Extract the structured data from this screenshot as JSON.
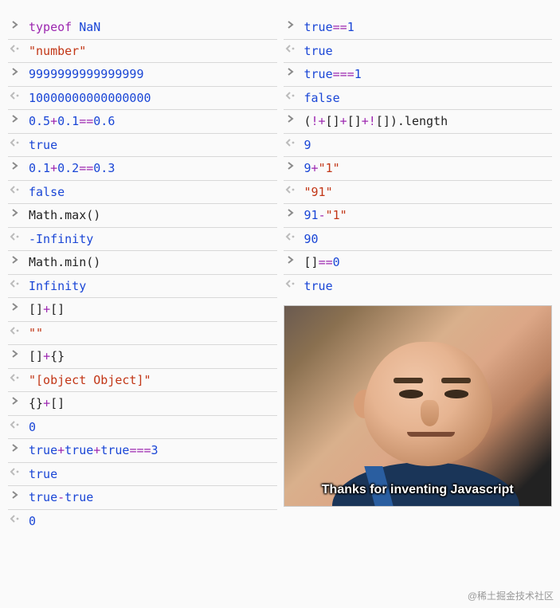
{
  "left": [
    {
      "type": "in",
      "tokens": [
        [
          "kw",
          "typeof"
        ],
        [
          "plain",
          " "
        ],
        [
          "num",
          "NaN"
        ]
      ]
    },
    {
      "type": "out",
      "tokens": [
        [
          "str",
          "\"number\""
        ]
      ]
    },
    {
      "type": "in",
      "tokens": [
        [
          "num",
          "9999999999999999"
        ]
      ]
    },
    {
      "type": "out",
      "tokens": [
        [
          "num",
          "10000000000000000"
        ]
      ]
    },
    {
      "type": "in",
      "tokens": [
        [
          "num",
          "0.5"
        ],
        [
          "op",
          "+"
        ],
        [
          "num",
          "0.1"
        ],
        [
          "op",
          "=="
        ],
        [
          "num",
          "0.6"
        ]
      ]
    },
    {
      "type": "out",
      "tokens": [
        [
          "bool",
          "true"
        ]
      ]
    },
    {
      "type": "in",
      "tokens": [
        [
          "num",
          "0.1"
        ],
        [
          "op",
          "+"
        ],
        [
          "num",
          "0.2"
        ],
        [
          "op",
          "=="
        ],
        [
          "num",
          "0.3"
        ]
      ]
    },
    {
      "type": "out",
      "tokens": [
        [
          "bool",
          "false"
        ]
      ]
    },
    {
      "type": "in",
      "tokens": [
        [
          "ident",
          "Math.max()"
        ]
      ]
    },
    {
      "type": "out",
      "tokens": [
        [
          "num",
          "-Infinity"
        ]
      ]
    },
    {
      "type": "in",
      "tokens": [
        [
          "ident",
          "Math.min()"
        ]
      ]
    },
    {
      "type": "out",
      "tokens": [
        [
          "num",
          "Infinity"
        ]
      ]
    },
    {
      "type": "in",
      "tokens": [
        [
          "plain",
          "[]"
        ],
        [
          "op",
          "+"
        ],
        [
          "plain",
          "[]"
        ]
      ]
    },
    {
      "type": "out",
      "tokens": [
        [
          "str",
          "\"\""
        ]
      ]
    },
    {
      "type": "in",
      "tokens": [
        [
          "plain",
          "[]"
        ],
        [
          "op",
          "+"
        ],
        [
          "plain",
          "{}"
        ]
      ]
    },
    {
      "type": "out",
      "tokens": [
        [
          "str",
          "\"[object Object]\""
        ]
      ]
    },
    {
      "type": "in",
      "tokens": [
        [
          "plain",
          "{}"
        ],
        [
          "op",
          "+"
        ],
        [
          "plain",
          "[]"
        ]
      ]
    },
    {
      "type": "out",
      "tokens": [
        [
          "num",
          "0"
        ]
      ]
    },
    {
      "type": "in",
      "tokens": [
        [
          "bool",
          "true"
        ],
        [
          "op",
          "+"
        ],
        [
          "bool",
          "true"
        ],
        [
          "op",
          "+"
        ],
        [
          "bool",
          "true"
        ],
        [
          "op",
          "==="
        ],
        [
          "num",
          "3"
        ]
      ]
    },
    {
      "type": "out",
      "tokens": [
        [
          "bool",
          "true"
        ]
      ]
    },
    {
      "type": "in",
      "tokens": [
        [
          "bool",
          "true"
        ],
        [
          "op",
          "-"
        ],
        [
          "bool",
          "true"
        ]
      ]
    },
    {
      "type": "out",
      "tokens": [
        [
          "num",
          "0"
        ]
      ]
    }
  ],
  "right": [
    {
      "type": "in",
      "tokens": [
        [
          "bool",
          "true"
        ],
        [
          "op",
          "=="
        ],
        [
          "num",
          "1"
        ]
      ]
    },
    {
      "type": "out",
      "tokens": [
        [
          "bool",
          "true"
        ]
      ]
    },
    {
      "type": "in",
      "tokens": [
        [
          "bool",
          "true"
        ],
        [
          "op",
          "==="
        ],
        [
          "num",
          "1"
        ]
      ]
    },
    {
      "type": "out",
      "tokens": [
        [
          "bool",
          "false"
        ]
      ]
    },
    {
      "type": "in",
      "tokens": [
        [
          "plain",
          "("
        ],
        [
          "op",
          "!+"
        ],
        [
          "plain",
          "[]"
        ],
        [
          "op",
          "+"
        ],
        [
          "plain",
          "[]"
        ],
        [
          "op",
          "+!"
        ],
        [
          "plain",
          "[]).length"
        ]
      ]
    },
    {
      "type": "out",
      "tokens": [
        [
          "num",
          "9"
        ]
      ]
    },
    {
      "type": "in",
      "tokens": [
        [
          "num",
          "9"
        ],
        [
          "op",
          "+"
        ],
        [
          "str",
          "\"1\""
        ]
      ]
    },
    {
      "type": "out",
      "tokens": [
        [
          "str",
          "\"91\""
        ]
      ]
    },
    {
      "type": "in",
      "tokens": [
        [
          "num",
          "91"
        ],
        [
          "op",
          "-"
        ],
        [
          "str",
          "\"1\""
        ]
      ]
    },
    {
      "type": "out",
      "tokens": [
        [
          "num",
          "90"
        ]
      ]
    },
    {
      "type": "in",
      "tokens": [
        [
          "plain",
          "[]"
        ],
        [
          "op",
          "=="
        ],
        [
          "num",
          "0"
        ]
      ]
    },
    {
      "type": "out",
      "tokens": [
        [
          "bool",
          "true"
        ]
      ]
    }
  ],
  "meme_caption": "Thanks for inventing Javascript",
  "watermark": "@稀土掘金技术社区"
}
